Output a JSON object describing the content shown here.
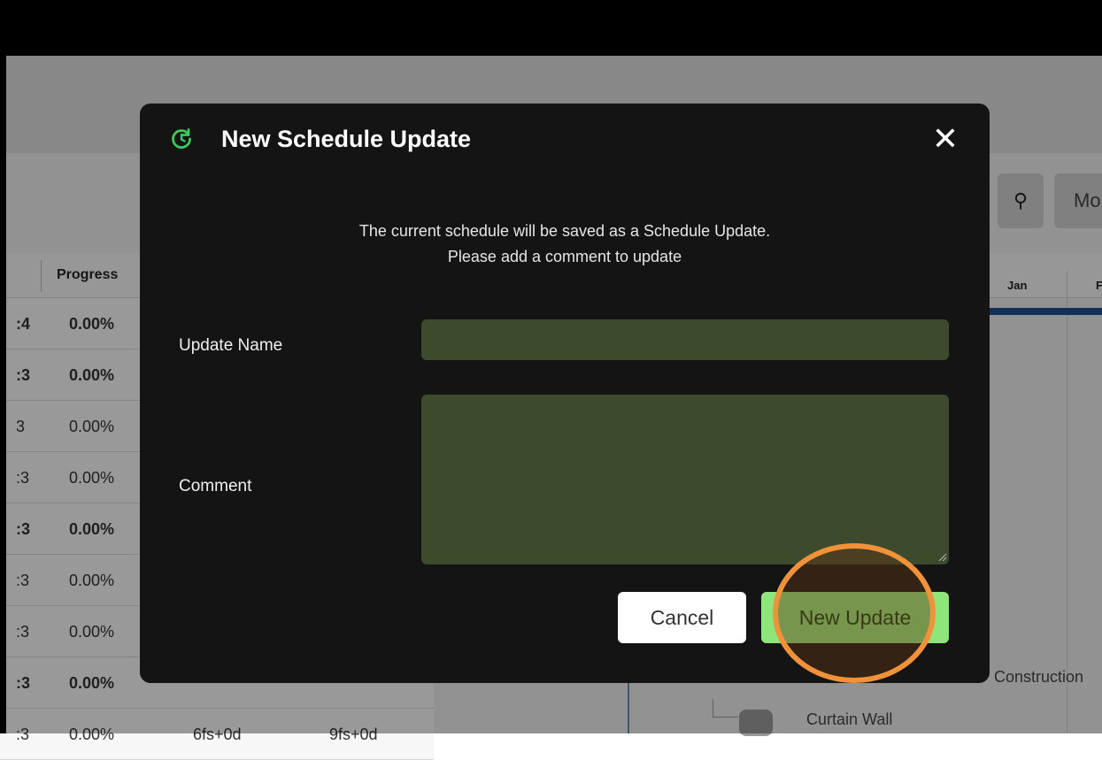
{
  "background": {
    "table": {
      "header_progress": "Progress",
      "rows": [
        {
          "c0": ":4",
          "progress": "0.00%",
          "bold": true
        },
        {
          "c0": ":3",
          "progress": "0.00%",
          "bold": true
        },
        {
          "c0": "3",
          "progress": "0.00%",
          "bold": false
        },
        {
          "c0": ":3",
          "progress": "0.00%",
          "bold": false
        },
        {
          "c0": ":3",
          "progress": "0.00%",
          "bold": true
        },
        {
          "c0": ":3",
          "progress": "0.00%",
          "bold": false
        },
        {
          "c0": ":3",
          "progress": "0.00%",
          "bold": false
        },
        {
          "c0": ":3",
          "progress": "0.00%",
          "bold": true
        },
        {
          "c0": ":3",
          "progress": "0.00%",
          "c2": "6fs+0d",
          "c3": "9fs+0d",
          "bold": false
        }
      ]
    },
    "toolbar": {
      "more_label": "Mo",
      "icon": "location-person-icon"
    },
    "gantt": {
      "month_jan": "Jan",
      "month_next": "F",
      "construction_label": "Construction",
      "curtain_label": "Curtain Wall"
    }
  },
  "dialog": {
    "title": "New Schedule Update",
    "icon": "refresh-icon",
    "close_icon": "close-icon",
    "close_glyph": "✕",
    "message_line1": "The current schedule will be saved as a Schedule Update.",
    "message_line2": "Please add a comment to update",
    "update_name_label": "Update Name",
    "update_name_value": "",
    "comment_label": "Comment",
    "comment_value": "",
    "cancel_label": "Cancel",
    "submit_label": "New Update",
    "accent_color": "#8ee57a",
    "input_bg_color": "#3d4a2c"
  },
  "annotation": {
    "highlight_color": "#f0923a"
  }
}
